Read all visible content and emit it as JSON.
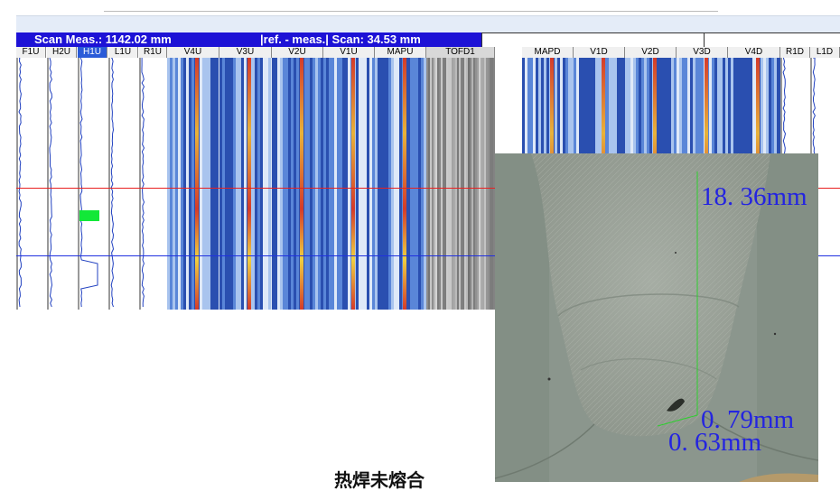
{
  "status": {
    "scan_meas": "Scan Meas.: 1142.02 mm",
    "ref_meas": "|ref. - meas.| Scan: 34.53 mm"
  },
  "channels": [
    {
      "label": "F1U",
      "type": "ascan"
    },
    {
      "label": "H2U",
      "type": "ascan"
    },
    {
      "label": "H1U",
      "type": "ascan",
      "selected": true
    },
    {
      "label": "L1U",
      "type": "ascan"
    },
    {
      "label": "R1U",
      "type": "ascan"
    },
    {
      "label": "V4U",
      "type": "scan"
    },
    {
      "label": "V3U",
      "type": "scan"
    },
    {
      "label": "V2U",
      "type": "scan"
    },
    {
      "label": "V1U",
      "type": "scan"
    },
    {
      "label": "MAPU",
      "type": "scan"
    },
    {
      "label": "TOFD1",
      "type": "tofd"
    },
    {
      "label": "MAPD",
      "type": "scan"
    },
    {
      "label": "V1D",
      "type": "scan"
    },
    {
      "label": "V2D",
      "type": "scan"
    },
    {
      "label": "V3D",
      "type": "scan"
    },
    {
      "label": "V4D",
      "type": "scan"
    },
    {
      "label": "R1D",
      "type": "ascan"
    },
    {
      "label": "L1D",
      "type": "ascan"
    }
  ],
  "macro_photo": {
    "measure_height": "18. 36mm",
    "measure_a": "0. 79mm",
    "measure_b": "0. 63mm"
  },
  "caption": "热焊未熔合",
  "colors": {
    "status_bg": "#1d12d6",
    "selected_channel": "#2a5bd8",
    "cursor_red": "#e82020",
    "cursor_blue": "#2030e0",
    "gate": "#12e838",
    "annotation": "#2424e0"
  }
}
